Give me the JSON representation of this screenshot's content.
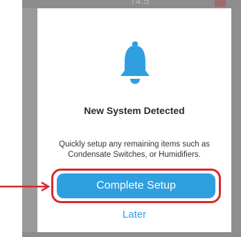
{
  "background": {
    "value_text": "74.5"
  },
  "modal": {
    "icon": "bell-icon",
    "title": "New System Detected",
    "description": "Quickly setup any remaining items such as Condensate Switches, or Humidifiers.",
    "primary_button_label": "Complete Setup",
    "secondary_button_label": "Later"
  },
  "annotation": {
    "arrow_icon": "arrow-right-icon",
    "highlight_color": "#d9262b"
  },
  "colors": {
    "accent": "#2f9fe0"
  }
}
